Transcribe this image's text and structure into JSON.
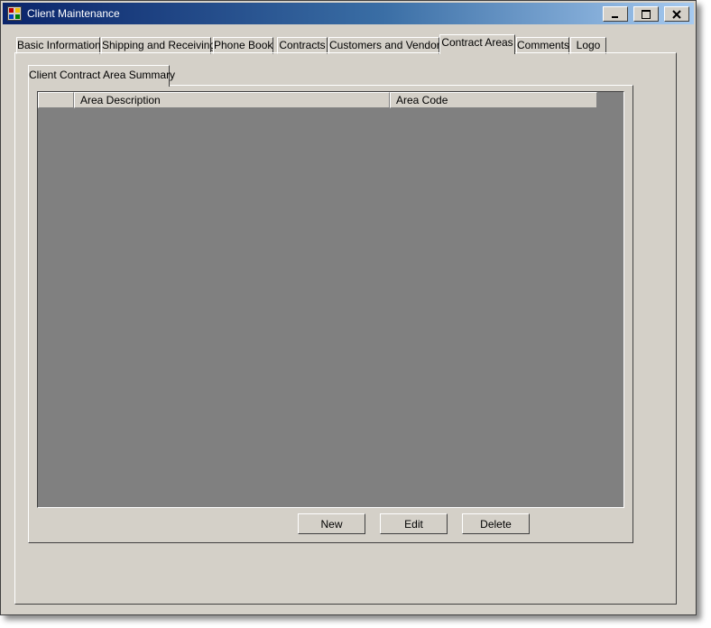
{
  "window": {
    "title": "Client Maintenance",
    "controls": {
      "minimize": "minimize-icon",
      "maximize": "maximize-icon",
      "close": "close-icon"
    }
  },
  "tabs": [
    {
      "label": "Basic Information",
      "active": false
    },
    {
      "label": "Shipping and Receiving",
      "active": false
    },
    {
      "label": "Phone Book",
      "active": false
    },
    {
      "label": "Contracts",
      "active": false
    },
    {
      "label": "Customers and Vendors",
      "active": false
    },
    {
      "label": "Contract Areas",
      "active": true
    },
    {
      "label": "Comments",
      "active": false
    },
    {
      "label": "Logo",
      "active": false
    }
  ],
  "inner_tab": {
    "label": "Client Contract Area Summary"
  },
  "grid": {
    "columns": [
      "",
      "Area Description",
      "Area Code"
    ],
    "rows": []
  },
  "buttons": {
    "new": "New",
    "edit": "Edit",
    "delete": "Delete"
  },
  "colors": {
    "window_bg": "#d4d0c8",
    "grid_bg": "#808080",
    "title_start": "#0a246a",
    "title_end": "#a6caf0"
  }
}
